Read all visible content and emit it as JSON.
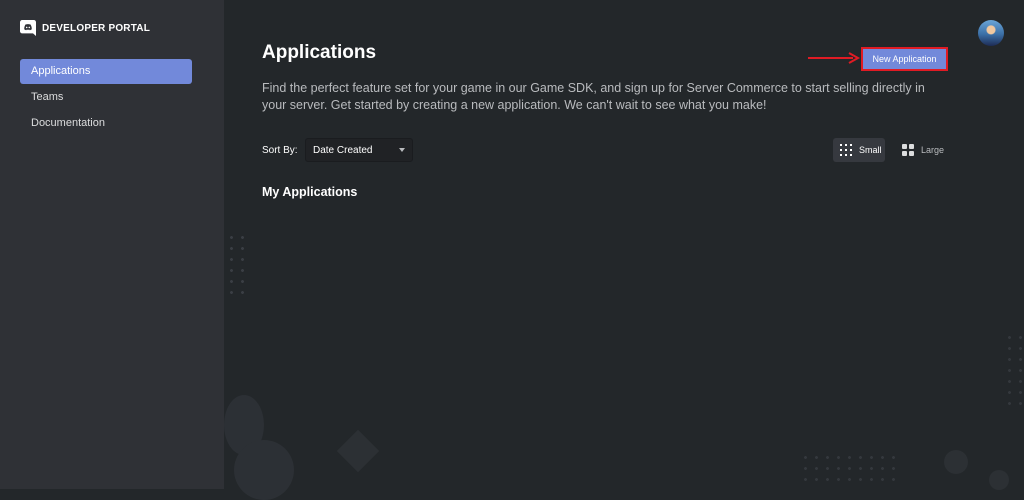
{
  "brand": {
    "title": "DEVELOPER PORTAL",
    "logo_icon": "discord-logo-icon"
  },
  "sidebar": {
    "items": [
      {
        "label": "Applications",
        "active": true
      },
      {
        "label": "Teams",
        "active": false
      },
      {
        "label": "Documentation",
        "active": false
      }
    ]
  },
  "header": {
    "title": "Applications",
    "new_application_label": "New Application"
  },
  "main": {
    "description": "Find the perfect feature set for your game in our Game SDK, and sign up for Server Commerce to start selling directly in your server. Get started by creating a new application. We can't wait to see what you make!",
    "sort": {
      "label": "Sort By:",
      "selected": "Date Created"
    },
    "view_toggle": {
      "small_label": "Small",
      "large_label": "Large",
      "selected": "Small"
    },
    "section_title": "My Applications"
  },
  "colors": {
    "background": "#23272a",
    "sidebar": "#2f3136",
    "accent": "#7289da",
    "annotation_red": "#e01b24"
  }
}
